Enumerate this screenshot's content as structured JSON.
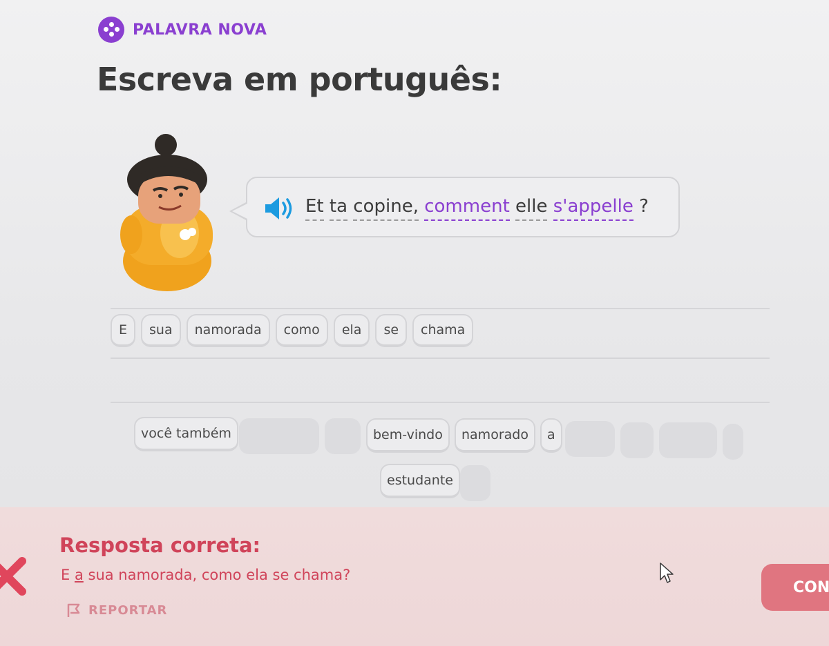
{
  "badge": {
    "label": "PALAVRA NOVA"
  },
  "title": "Escreva em português:",
  "prompt": {
    "words": [
      "Et",
      "ta",
      "copine,",
      "comment",
      "elle",
      "s'appelle",
      "?"
    ],
    "highlighted": [
      "comment",
      "s'appelle"
    ],
    "icon": "speaker-icon"
  },
  "answer_chips": [
    "E",
    "sua",
    "namorada",
    "como",
    "ela",
    "se",
    "chama"
  ],
  "word_bank": {
    "row1": [
      "você também",
      "bem-vindo",
      "namorado",
      "a"
    ],
    "row2": [
      "estudante"
    ]
  },
  "feedback": {
    "heading": "Resposta correta:",
    "answer_pre": "E ",
    "answer_marked": "a",
    "answer_post": " sua namorada, como ela se chama?",
    "report_label": "REPORTAR",
    "continue_label": "CON"
  },
  "colors": {
    "accent": "#8a3fd0",
    "error": "#d0445a",
    "button": "#e07580"
  }
}
